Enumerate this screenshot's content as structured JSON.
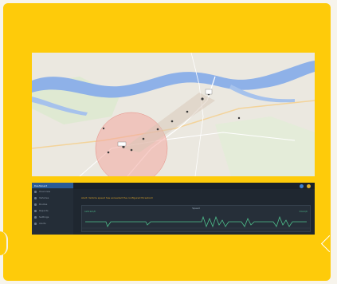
{
  "colors": {
    "card": "#fecb0a",
    "river": "#8eb1e8",
    "range_circle": "#f3a7a0",
    "sidebar_active": "#2b5b96",
    "alert": "#d8a22b",
    "chart_line": "#4fc08d"
  },
  "map": {
    "view": "street-map",
    "layers": [
      "river",
      "roads",
      "range-circle",
      "route-markers"
    ]
  },
  "dashboard": {
    "sidebar": {
      "active_label": "Dashboard",
      "items": [
        {
          "label": "Overview",
          "icon": "grid-icon"
        },
        {
          "label": "Vehicles",
          "icon": "car-icon"
        },
        {
          "label": "Routes",
          "icon": "route-icon"
        },
        {
          "label": "Reports",
          "icon": "chart-icon"
        },
        {
          "label": "Settings",
          "icon": "gear-icon"
        },
        {
          "label": "Alerts",
          "icon": "bell-icon"
        }
      ]
    },
    "alert_text": "Alert: Vehicle speed has exceeded the configured threshold",
    "panel": {
      "title": "Speed",
      "left_label": "120 km/h",
      "right_label": "0 km/h"
    }
  }
}
